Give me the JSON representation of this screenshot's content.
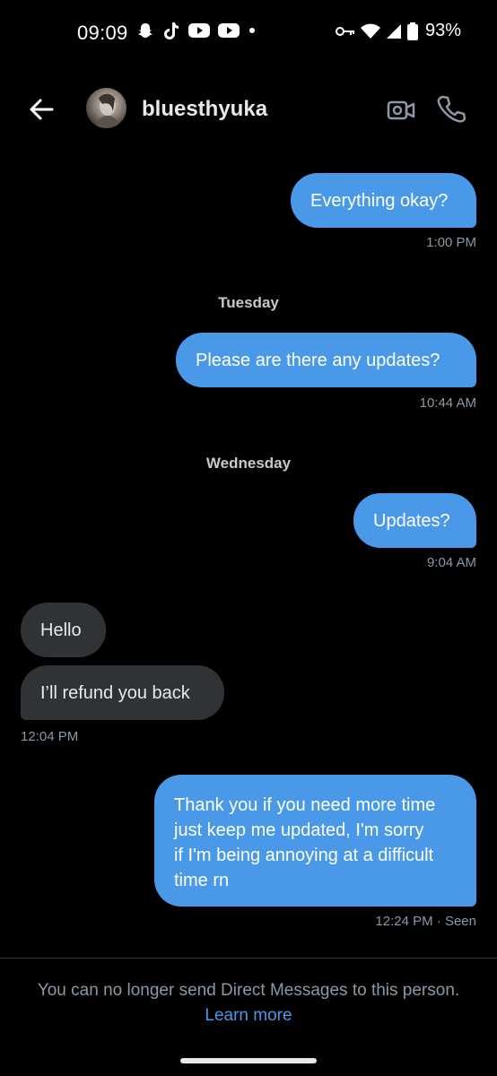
{
  "status_bar": {
    "time": "09:09",
    "battery": "93%",
    "left_icons": [
      "snapchat-icon",
      "tiktok-icon",
      "youtube-icon",
      "youtube-icon",
      "dot-icon"
    ],
    "right_icons": [
      "vpn-key-icon",
      "wifi-icon",
      "cellular-icon",
      "battery-icon"
    ]
  },
  "header": {
    "contact_name": "bluesthyuka",
    "back_icon": "arrow-left-icon",
    "video_icon": "video-call-icon",
    "call_icon": "phone-icon"
  },
  "messages": [
    {
      "direction": "out",
      "text": "Everything okay?",
      "time": "1:00 PM"
    },
    {
      "day_separator": "Tuesday"
    },
    {
      "direction": "out",
      "text": "Please are there any updates?",
      "time": "10:44 AM"
    },
    {
      "day_separator": "Wednesday"
    },
    {
      "direction": "out",
      "text": "Updates?",
      "time": "9:04 AM"
    },
    {
      "direction": "in",
      "text": "Hello"
    },
    {
      "direction": "in",
      "text": "I’ll refund you back",
      "time": "12:04 PM"
    },
    {
      "direction": "out",
      "text_lines": [
        "Thank you if you need more time",
        "just keep me updated, I'm sorry",
        "if I'm being annoying at a difficult",
        "time rn"
      ],
      "time": "12:24 PM · Seen"
    }
  ],
  "footer": {
    "notice": "You can no longer send Direct Messages to this person.",
    "link": "Learn more"
  },
  "colors": {
    "background": "#000000",
    "outgoing_bubble": "#4a99e9",
    "incoming_bubble": "#2f3336",
    "link": "#4a99e9",
    "timestamp": "#8b98a5"
  }
}
